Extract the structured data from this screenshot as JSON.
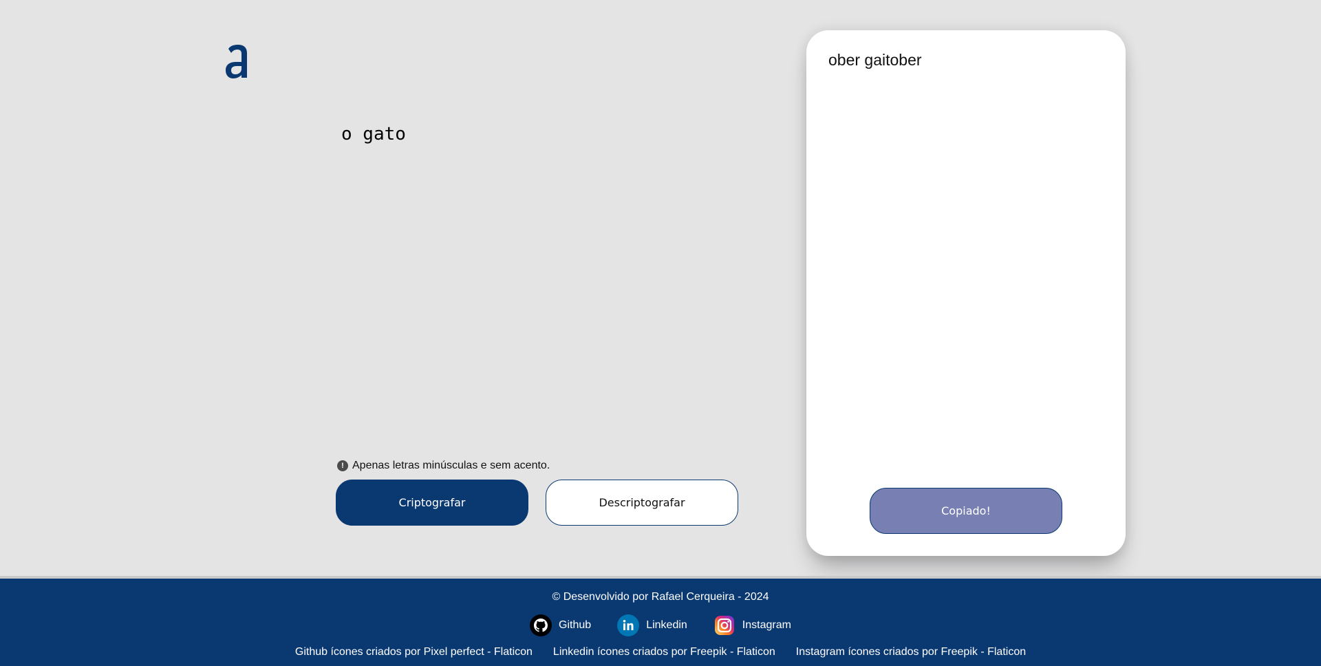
{
  "logo": {
    "glyph": "a",
    "color": "#0a3871"
  },
  "input": {
    "value": "o gato"
  },
  "hint": {
    "icon": "info-icon",
    "text": "Apenas letras minúsculas e sem acento."
  },
  "buttons": {
    "encrypt_label": "Criptografar",
    "decrypt_label": "Descriptografar",
    "copy_label": "Copiado!"
  },
  "output": {
    "text": "ober gaitober"
  },
  "footer": {
    "credit": "© Desenvolvido por Rafael Cerqueira - 2024",
    "socials": [
      {
        "icon": "github-icon",
        "label": "Github"
      },
      {
        "icon": "linkedin-icon",
        "label": "Linkedin"
      },
      {
        "icon": "instagram-icon",
        "label": "Instagram"
      }
    ],
    "attributions": [
      "Github ícones criados por Pixel perfect - Flaticon",
      "Linkedin ícones criados por Freepik - Flaticon",
      "Instagram ícones criados por Freepik - Flaticon"
    ]
  },
  "colors": {
    "background": "#e4e4e5",
    "brand": "#0a3871",
    "copy_button": "#7880b3",
    "card": "#ffffff"
  }
}
